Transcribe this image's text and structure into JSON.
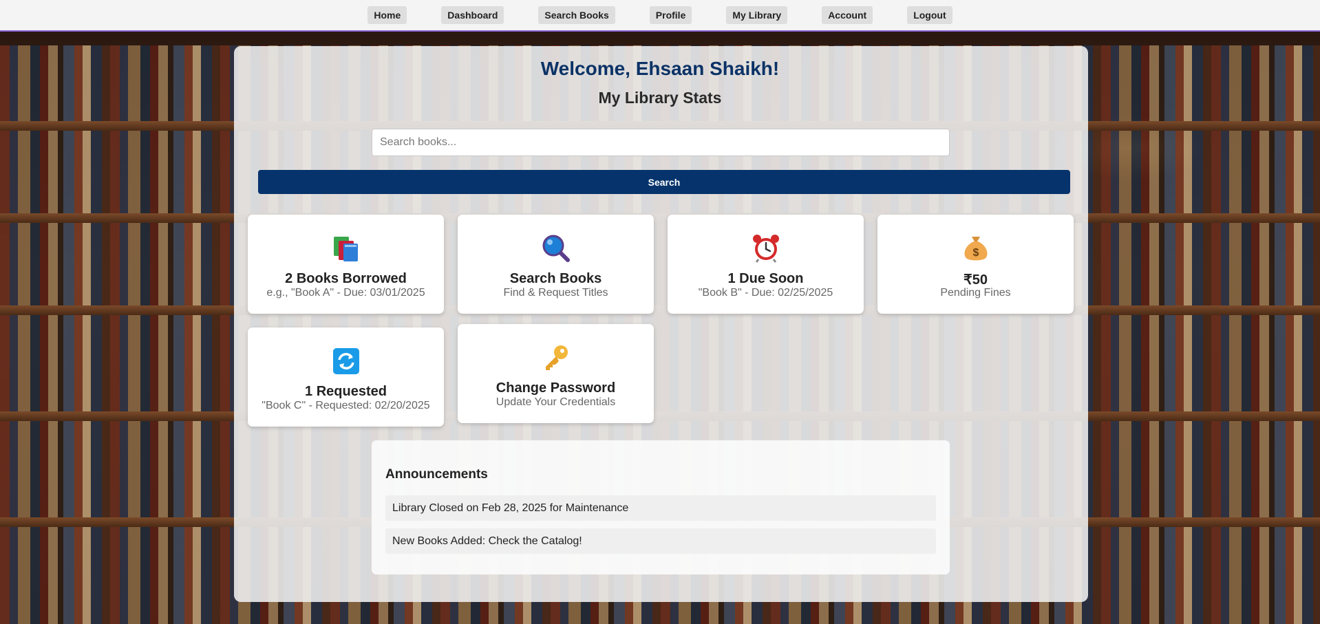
{
  "nav": {
    "items": [
      "Home",
      "Dashboard",
      "Search Books",
      "Profile",
      "My Library",
      "Account",
      "Logout"
    ]
  },
  "header": {
    "welcome": "Welcome, Ehsaan Shaikh!",
    "stats_title": "My Library Stats"
  },
  "search": {
    "placeholder": "Search books...",
    "value": "",
    "button_label": "Search"
  },
  "cards": [
    {
      "icon": "books-icon",
      "title": "2 Books Borrowed",
      "subtitle": "e.g., \"Book A\" - Due: 03/01/2025"
    },
    {
      "icon": "magnifier-icon",
      "title": "Search Books",
      "subtitle": "Find & Request Titles"
    },
    {
      "icon": "alarm-clock-icon",
      "title": "1 Due Soon",
      "subtitle": "\"Book B\" - Due: 02/25/2025"
    },
    {
      "icon": "money-bag-icon",
      "title": "₹50",
      "subtitle": "Pending Fines"
    },
    {
      "icon": "refresh-icon",
      "title": "1 Requested",
      "subtitle": "\"Book C\" - Requested: 02/20/2025"
    },
    {
      "icon": "key-icon",
      "title": "Change Password",
      "subtitle": "Update Your Credentials"
    }
  ],
  "announcements": {
    "title": "Announcements",
    "items": [
      "Library Closed on Feb 28, 2025 for Maintenance",
      "New Books Added: Check the Catalog!"
    ]
  },
  "colors": {
    "primary": "#06336b",
    "welcome_text": "#0b3266",
    "nav_border": "#8a63d2"
  }
}
